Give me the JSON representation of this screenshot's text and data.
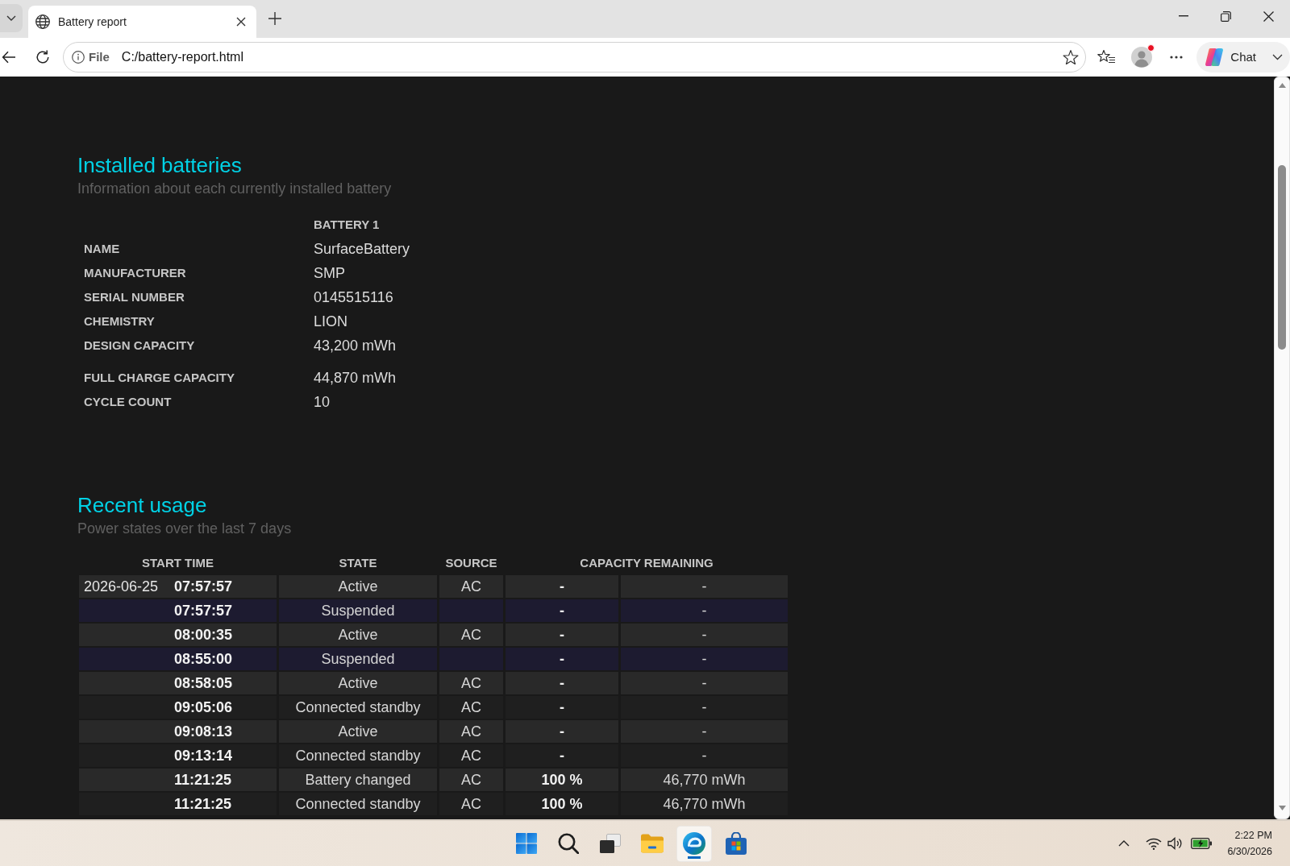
{
  "browser": {
    "tabs": [
      {
        "title": "Battery report",
        "selected": true
      }
    ],
    "address": {
      "site_info": "File",
      "url": "C:/battery-report.html"
    },
    "profile": {
      "notification": true
    },
    "chat_button": {
      "label": "Chat"
    }
  },
  "installed_batteries": {
    "title": "Installed batteries",
    "subtitle": "Information about each currently installed battery",
    "column_header": "BATTERY 1",
    "groups": [
      {
        "rows": [
          {
            "label": "NAME",
            "value": "SurfaceBattery"
          },
          {
            "label": "MANUFACTURER",
            "value": "SMP"
          },
          {
            "label": "SERIAL NUMBER",
            "value": "0145515116"
          },
          {
            "label": "CHEMISTRY",
            "value": "LION"
          },
          {
            "label": "DESIGN CAPACITY",
            "value": "43,200 mWh"
          }
        ]
      },
      {
        "rows": [
          {
            "label": "FULL CHARGE CAPACITY",
            "value": "44,870 mWh"
          },
          {
            "label": "CYCLE COUNT",
            "value": "10"
          }
        ]
      }
    ]
  },
  "recent_usage": {
    "title": "Recent usage",
    "subtitle": "Power states over the last 7 days",
    "columns": [
      "START TIME",
      "STATE",
      "SOURCE",
      "CAPACITY REMAINING"
    ],
    "rows": [
      {
        "date": "2026-06-25",
        "time": "07:57:57",
        "state": "Active",
        "source": "AC",
        "capacity_percent": "-",
        "capacity_energy": "-",
        "suspended": false
      },
      {
        "time": "07:57:57",
        "state": "Suspended",
        "capacity_percent": "-",
        "capacity_energy": "-",
        "suspended": true
      },
      {
        "time": "08:00:35",
        "state": "Active",
        "source": "AC",
        "capacity_percent": "-",
        "capacity_energy": "-",
        "suspended": false
      },
      {
        "time": "08:55:00",
        "state": "Suspended",
        "capacity_percent": "-",
        "capacity_energy": "-",
        "suspended": true
      },
      {
        "time": "08:58:05",
        "state": "Active",
        "source": "AC",
        "capacity_percent": "-",
        "capacity_energy": "-",
        "suspended": false
      },
      {
        "time": "09:05:06",
        "state": "Connected standby",
        "source": "AC",
        "capacity_percent": "-",
        "capacity_energy": "-",
        "suspended": false
      },
      {
        "time": "09:08:13",
        "state": "Active",
        "source": "AC",
        "capacity_percent": "-",
        "capacity_energy": "-",
        "suspended": false
      },
      {
        "time": "09:13:14",
        "state": "Connected standby",
        "source": "AC",
        "capacity_percent": "-",
        "capacity_energy": "-",
        "suspended": false
      },
      {
        "time": "11:21:25",
        "state": "Battery changed",
        "source": "AC",
        "capacity_percent": "100 %",
        "capacity_energy": "46,770 mWh",
        "suspended": false
      },
      {
        "time": "11:21:25",
        "state": "Connected standby",
        "source": "AC",
        "capacity_percent": "100 %",
        "capacity_energy": "46,770 mWh",
        "suspended": false
      }
    ]
  },
  "taskbar": {
    "apps": [
      {
        "kind": "start",
        "selected": false
      },
      {
        "kind": "search",
        "selected": false
      },
      {
        "kind": "task-view",
        "selected": false
      },
      {
        "kind": "files",
        "selected": false
      },
      {
        "kind": "browser",
        "selected": true
      },
      {
        "kind": "store",
        "selected": false
      }
    ],
    "clock": {
      "time": "2:22 PM",
      "date": "6/30/2026"
    }
  }
}
